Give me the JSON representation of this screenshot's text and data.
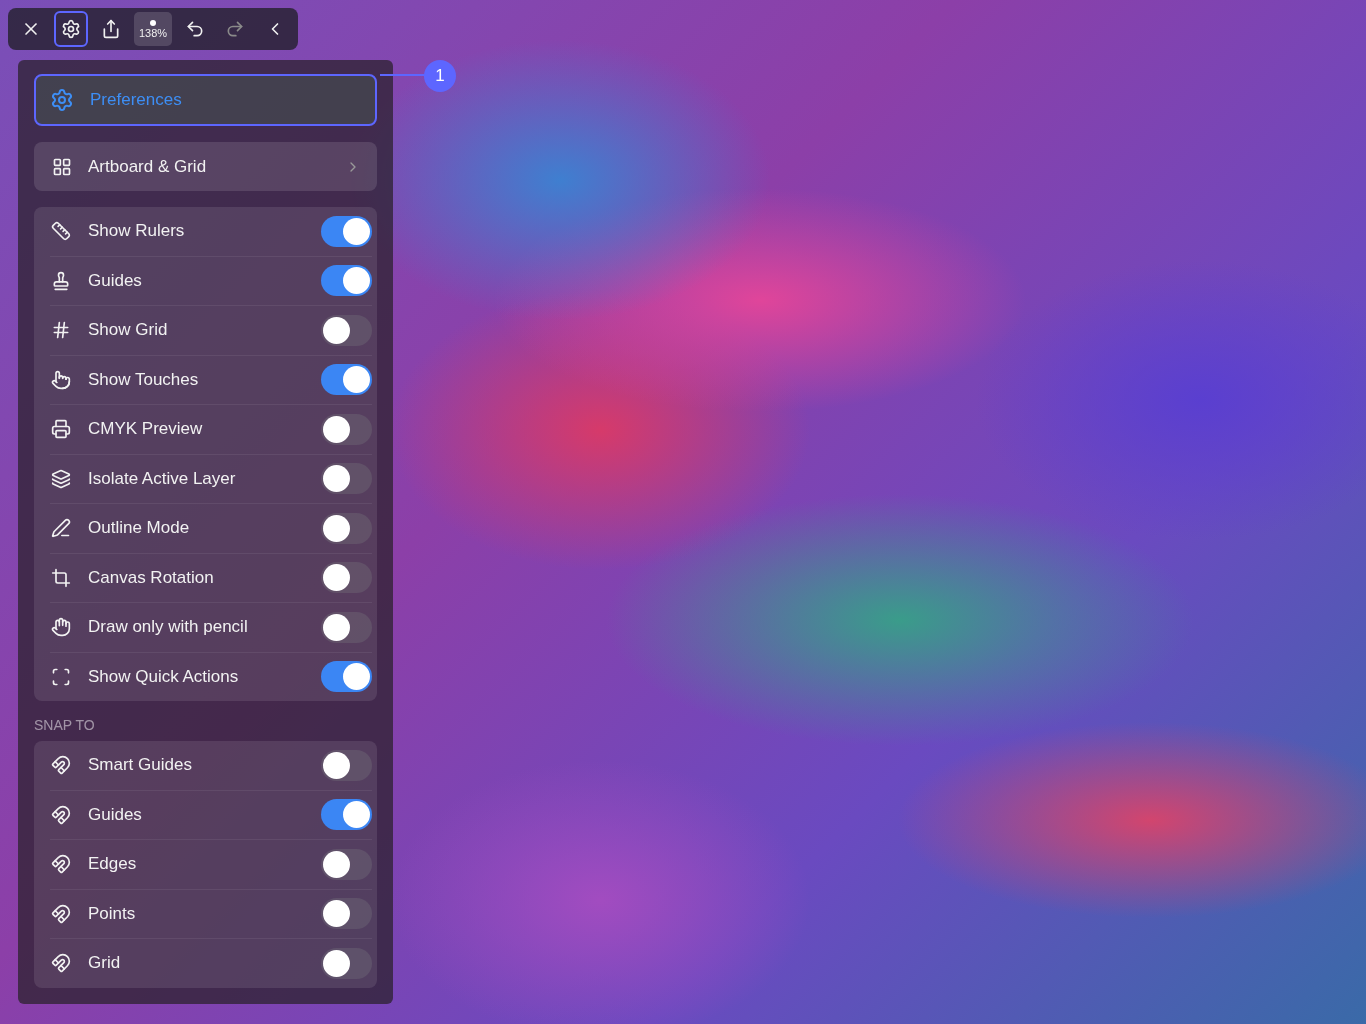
{
  "toolbar": {
    "buttons": [
      {
        "kind": "close",
        "selected": false,
        "disabled": false
      },
      {
        "kind": "settings",
        "selected": true,
        "disabled": false
      },
      {
        "kind": "share",
        "selected": false,
        "disabled": false
      },
      {
        "kind": "zoom",
        "label": "138%",
        "selected": false,
        "disabled": false
      },
      {
        "kind": "undo",
        "selected": false,
        "disabled": false
      },
      {
        "kind": "redo",
        "selected": false,
        "disabled": true
      },
      {
        "kind": "collapse",
        "selected": false,
        "disabled": false
      }
    ]
  },
  "panel": {
    "header": {
      "label": "Preferences",
      "selected": true
    },
    "callout": "1",
    "link": {
      "label": "Artboard & Grid"
    },
    "settings": [
      {
        "label": "Show Rulers",
        "on": true
      },
      {
        "label": "Guides",
        "on": true
      },
      {
        "label": "Show Grid",
        "on": false
      },
      {
        "label": "Show Touches",
        "on": true
      },
      {
        "label": "CMYK Preview",
        "on": false
      },
      {
        "label": "Isolate Active Layer",
        "on": false
      },
      {
        "label": "Outline Mode",
        "on": false
      },
      {
        "label": "Canvas Rotation",
        "on": false
      },
      {
        "label": "Draw only with pencil",
        "on": false
      },
      {
        "label": "Show Quick Actions",
        "on": true
      }
    ],
    "snap_heading": "SNAP TO",
    "snap": [
      {
        "label": "Smart Guides",
        "on": false
      },
      {
        "label": "Guides",
        "on": true
      },
      {
        "label": "Edges",
        "on": false
      },
      {
        "label": "Points",
        "on": false
      },
      {
        "label": "Grid",
        "on": false
      }
    ]
  }
}
